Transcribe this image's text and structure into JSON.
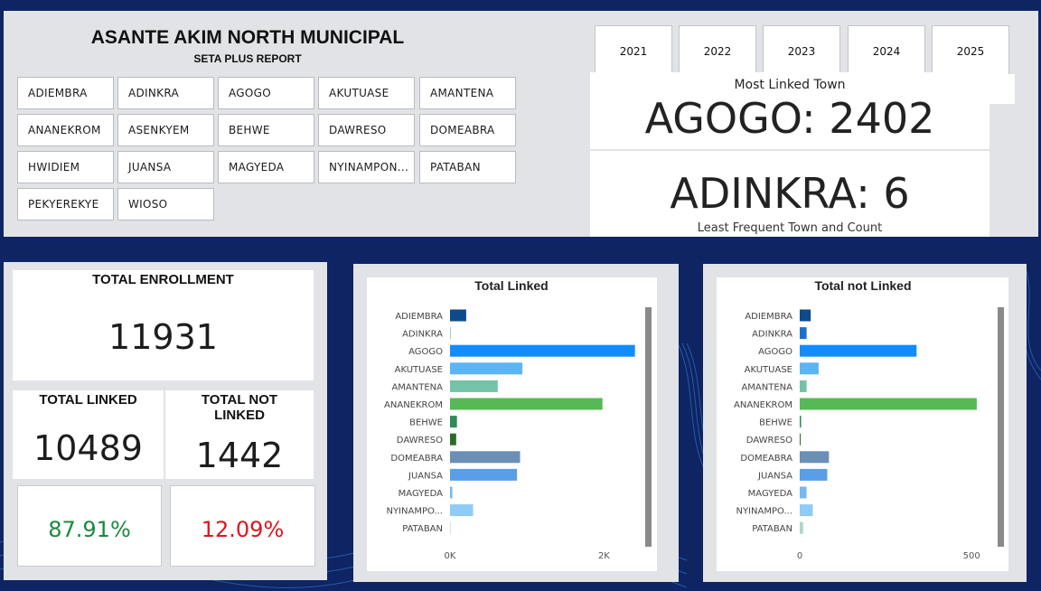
{
  "header": {
    "title": "ASANTE AKIM NORTH MUNICIPAL",
    "subtitle": "SETA PLUS REPORT"
  },
  "towns": [
    "ADIEMBRA",
    "ADINKRA",
    "AGOGO",
    "AKUTUASE",
    "AMANTENA",
    "ANANEKROM",
    "ASENKYEM",
    "BEHWE",
    "DAWRESO",
    "DOMEABRA",
    "HWIDIEM",
    "JUANSA",
    "MAGYEDA",
    "NYINAMPON...",
    "PATABAN",
    "PEKYEREKYE",
    "WIOSO"
  ],
  "years": [
    "2021",
    "2022",
    "2023",
    "2024",
    "2025"
  ],
  "most_linked": {
    "label": "Most Linked Town",
    "value": "AGOGO: 2402"
  },
  "least_linked": {
    "label": "Least Frequent Town and Count",
    "value": "ADINKRA: 6"
  },
  "kpis": {
    "total_enrollment_label": "TOTAL ENROLLMENT",
    "total_enrollment_value": "11931",
    "total_linked_label": "TOTAL LINKED",
    "total_linked_value": "10489",
    "total_not_linked_label_1": "TOTAL NOT",
    "total_not_linked_label_2": "LINKED",
    "total_not_linked_value": "1442",
    "linked_pct": "87.91%",
    "not_linked_pct": "12.09%"
  },
  "colors": {
    "pct_positive": "#1a8a3c",
    "pct_negative": "#e0141e"
  },
  "chart_data": [
    {
      "type": "bar",
      "orientation": "horizontal",
      "title": "Total Linked",
      "categories": [
        "ADIEMBRA",
        "ADINKRA",
        "AGOGO",
        "AKUTUASE",
        "AMANTENA",
        "ANANEKROM",
        "BEHWE",
        "DAWRESO",
        "DOMEABRA",
        "JUANSA",
        "MAGYEDA",
        "NYINAMPO...",
        "PATABAN"
      ],
      "values": [
        210,
        6,
        2402,
        940,
        620,
        1980,
        90,
        80,
        910,
        870,
        30,
        300,
        0
      ],
      "colors": [
        "#0c4a8c",
        "#9ec9e8",
        "#118dff",
        "#5bb5f5",
        "#74c2a8",
        "#56b956",
        "#2e8b57",
        "#2c6a2c",
        "#6b8fb5",
        "#5a9ee8",
        "#78b8f0",
        "#8fcbf7",
        "#a9d8c8"
      ],
      "xticks": [
        {
          "value": 0,
          "label": "0K"
        },
        {
          "value": 2000,
          "label": "2K"
        }
      ],
      "xlim": [
        0,
        2500
      ]
    },
    {
      "type": "bar",
      "orientation": "horizontal",
      "title": "Total not Linked",
      "categories": [
        "ADIEMBRA",
        "ADINKRA",
        "AGOGO",
        "AKUTUASE",
        "AMANTENA",
        "ANANEKROM",
        "BEHWE",
        "DAWRESO",
        "DOMEABRA",
        "JUANSA",
        "MAGYEDA",
        "NYINAMPO...",
        "PATABAN"
      ],
      "values": [
        32,
        20,
        340,
        55,
        20,
        515,
        4,
        2,
        85,
        80,
        20,
        38,
        10
      ],
      "colors": [
        "#0c4a8c",
        "#1c6fd0",
        "#118dff",
        "#5bb5f5",
        "#74c2a8",
        "#56b956",
        "#2e8b57",
        "#2c6a2c",
        "#6b8fb5",
        "#5a9ee8",
        "#78b8f0",
        "#8fcbf7",
        "#a9d8c8"
      ],
      "xticks": [
        {
          "value": 0,
          "label": "0"
        },
        {
          "value": 500,
          "label": "500"
        }
      ],
      "xlim": [
        0,
        560
      ]
    }
  ]
}
